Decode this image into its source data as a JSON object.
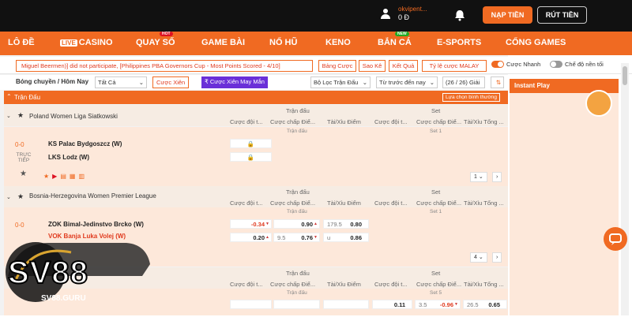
{
  "topbar": {
    "username": "okvipent...",
    "balance": "0 Đ",
    "deposit_label": "NẠP TIỀN",
    "withdraw_label": "RÚT TIỀN"
  },
  "nav": {
    "items": [
      {
        "label": "LÔ ĐỀ"
      },
      {
        "label": "CASINO",
        "badge": "LIVE"
      },
      {
        "label": "QUAY SỐ",
        "tag": "HOT"
      },
      {
        "label": "GAME BÀI"
      },
      {
        "label": "NỔ HŨ"
      },
      {
        "label": "KENO"
      },
      {
        "label": "BẮN CÁ",
        "tag": "NEW"
      },
      {
        "label": "E-SPORTS"
      },
      {
        "label": "CỔNG GAMES"
      }
    ]
  },
  "ticker": {
    "text": "Miguel Beermen)] did not participate, [Philippines PBA Governors Cup - Most Points Scored - 4/10]",
    "buttons": [
      "Bảng Cược",
      "Sao Kê",
      "Kết Quả",
      "Tỷ lệ cược MALAY"
    ],
    "fast_bet_label": "Cược Nhanh",
    "dark_mode_label": "Chế độ nền tối"
  },
  "filters": {
    "sport_label": "Bóng chuyền / Hôm Nay",
    "all_select": "Tất Cả",
    "parlay_label": "Cược Xiên",
    "lucky_parlay_label": "₹ Cược Xiên May Mắn",
    "match_filter": "Bộ Lọc Trận Đấu",
    "sort": "Từ trước đến nay",
    "count": "(26 / 26) Giải"
  },
  "table": {
    "column_title": "Trận Đấu",
    "choose_type": "Lựa chọn bình thường",
    "group_match": "Trận đấu",
    "group_set": "Set",
    "headers": [
      "Cược đội t...",
      "Cược chấp Điể...",
      "Tài/Xỉu Điểm",
      "Cược đội t...",
      "Cược chấp Điể...",
      "Tài/Xỉu Tổng ..."
    ]
  },
  "leagues": [
    {
      "name": "Poland Women Liga Siatkowski",
      "sub_left": "Trận đấu",
      "sub_right": "Set 1",
      "score": "0-0",
      "status": "TRỰC TIẾP",
      "home": "KS Palac Bydgoszcz (W)",
      "away": "LKS Lodz (W)",
      "page": "1"
    },
    {
      "name": "Bosnia-Herzegovina Women Premier League",
      "sub_left": "Trận đấu",
      "sub_right": "Set 1",
      "score": "0-0",
      "home": "ZOK Bimal-Jedinstvo Brcko (W)",
      "away": "VOK Banja Luka Volej (W)",
      "home_ml": "-0.34",
      "away_ml": "0.20",
      "home_hcp_odd": "0.90",
      "away_hcp": "9.5",
      "away_hcp_odd": "0.76",
      "ou_line": "179.5",
      "over_odd": "0.80",
      "ou_under": "u",
      "under_odd": "0.86",
      "page": "4"
    },
    {
      "sub_left": "Trận đấu",
      "sub_right": "Set 5",
      "set_ml": "0.11",
      "set_hcp": "3.5",
      "set_hcp_odd": "-0.96",
      "set_ou_line": "26.5",
      "set_ou_odd": "0.65"
    }
  ],
  "sidebar": {
    "instant_play": "Instant Play"
  },
  "brand": {
    "logo": "SV88",
    "url": "SV88.GURU"
  },
  "colors": {
    "accent": "#f06a22",
    "dark": "#111111",
    "alert": "#e03a1e"
  }
}
